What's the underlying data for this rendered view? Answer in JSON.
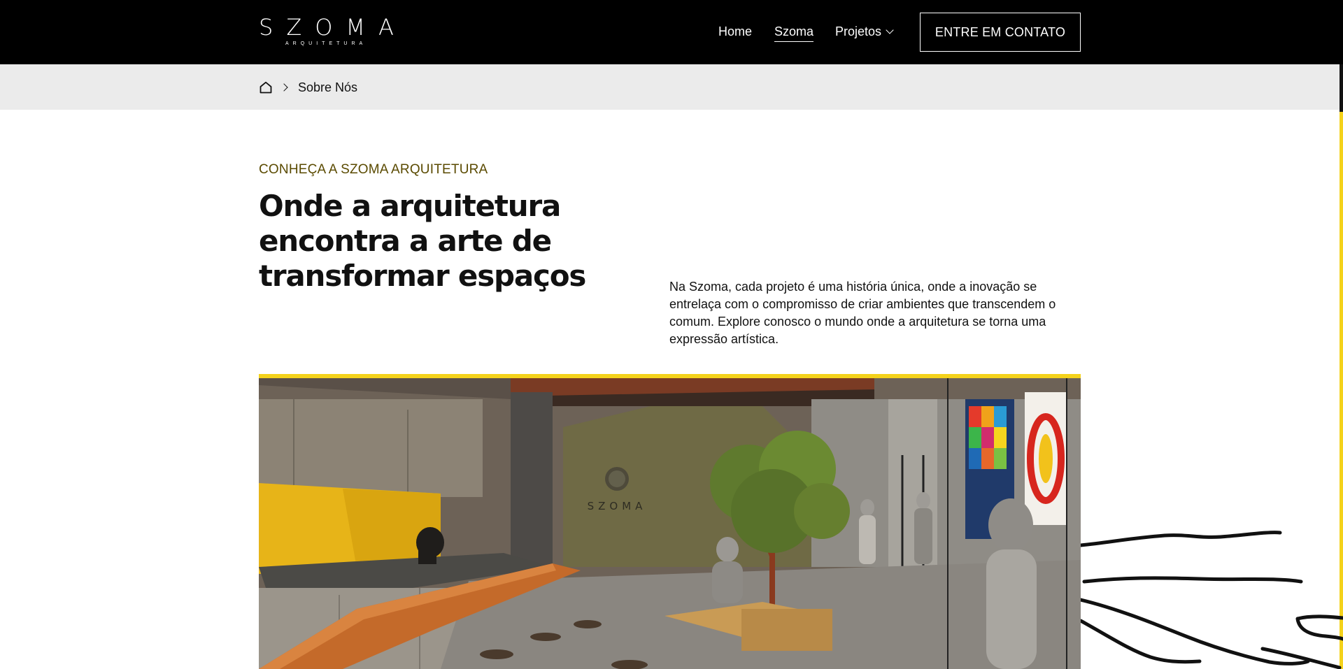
{
  "header": {
    "logo": {
      "main": "SZOMA",
      "sub": "ARQUITETURA"
    },
    "nav": {
      "home": "Home",
      "szoma": "Szoma",
      "projetos": "Projetos"
    },
    "cta_label": "ENTRE EM CONTATO"
  },
  "breadcrumb": {
    "home_icon": "home-icon",
    "current": "Sobre Nós"
  },
  "intro": {
    "eyebrow": "CONHEÇA A SZOMA ARQUITETURA",
    "headline": "Onde a arquitetura encontra a arte de transformar espaços",
    "paragraph": "Na Szoma, cada projeto é uma história única, onde a inovação se entrelaça com o compromisso de criar ambientes que transcendem o comum. Explore conosco o mundo onde a arquitetura se torna uma expressão artística."
  },
  "hero": {
    "wall_sign": "SZOMA"
  },
  "colors": {
    "accent": "#f4d21b",
    "header_bg": "#000000",
    "breadcrumb_bg": "#ebebeb",
    "eyebrow": "#5a4a00"
  }
}
